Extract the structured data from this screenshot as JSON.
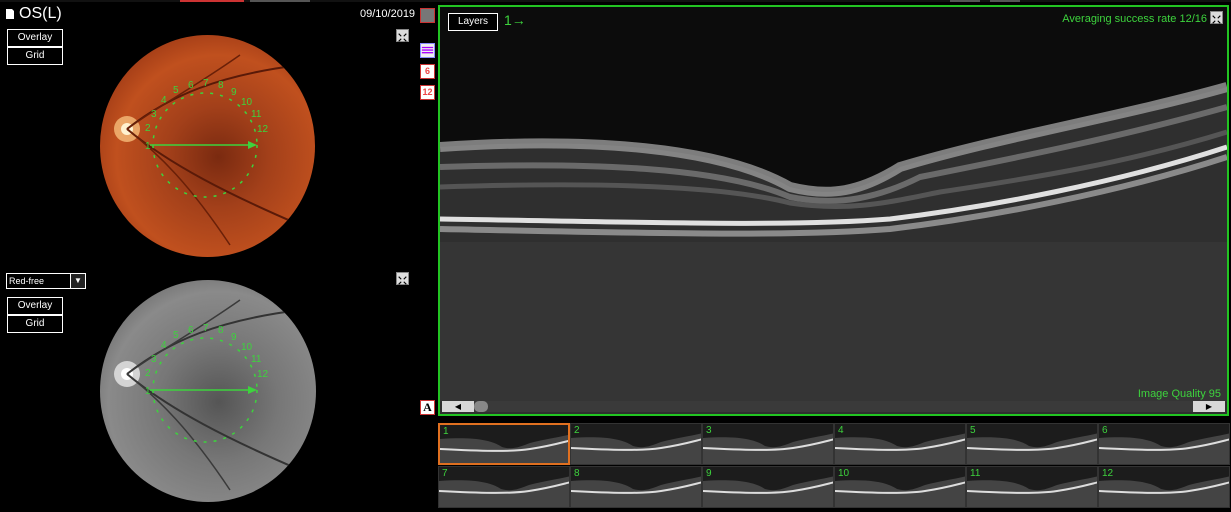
{
  "header": {
    "eye_label": "OS(L)",
    "date": "09/10/2019"
  },
  "top_fundus": {
    "overlay_label": "Overlay",
    "grid_label": "Grid"
  },
  "bottom_fundus": {
    "mode_select": "Red-free",
    "overlay_label": "Overlay",
    "grid_label": "Grid"
  },
  "grid_numbers": [
    "1",
    "2",
    "3",
    "4",
    "5",
    "6",
    "7",
    "8",
    "9",
    "10",
    "11",
    "12"
  ],
  "side_icons": {
    "six_label": "6",
    "twelve_label": "12",
    "annotate_label": "A"
  },
  "oct": {
    "layers_label": "Layers",
    "scan_indicator": "1→",
    "averaging": "Averaging success rate 12/16",
    "image_quality": "Image Quality 95"
  },
  "thumbnails": [
    {
      "label": "1",
      "selected": true
    },
    {
      "label": "2"
    },
    {
      "label": "3"
    },
    {
      "label": "4"
    },
    {
      "label": "5"
    },
    {
      "label": "6"
    },
    {
      "label": "7"
    },
    {
      "label": "8"
    },
    {
      "label": "9"
    },
    {
      "label": "10"
    },
    {
      "label": "11"
    },
    {
      "label": "12"
    }
  ],
  "colors": {
    "accent_green": "#22c422",
    "selection_orange": "#e07020"
  }
}
